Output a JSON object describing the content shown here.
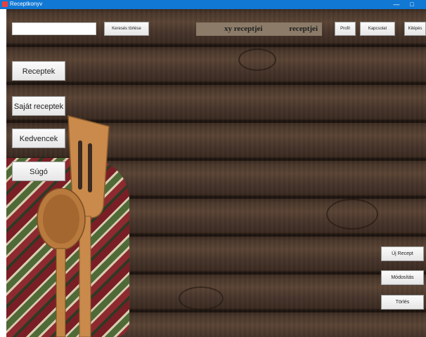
{
  "window": {
    "title": "Receptkonyv",
    "min_glyph": "—",
    "max_glyph": "□"
  },
  "search": {
    "value": "",
    "clear_label": "Keresés törlése"
  },
  "header": {
    "user_text_1": "xy receptjei",
    "user_text_2": "receptjei",
    "profile_label": "Profil",
    "contact_label": "Kapcsolat",
    "logout_label": "Kilépés"
  },
  "nav": {
    "recipes_label": "Receptek",
    "own_recipes_label": "Saját receptek",
    "favorites_label": "Kedvencek",
    "help_label": "Súgó"
  },
  "actions": {
    "new_label": "Új Recept",
    "edit_label": "Módosítás",
    "delete_label": "Törlés"
  },
  "colors": {
    "titlebar": "#1178d4",
    "wood": "#3a2a20",
    "user_panel": "#8b7b68"
  }
}
